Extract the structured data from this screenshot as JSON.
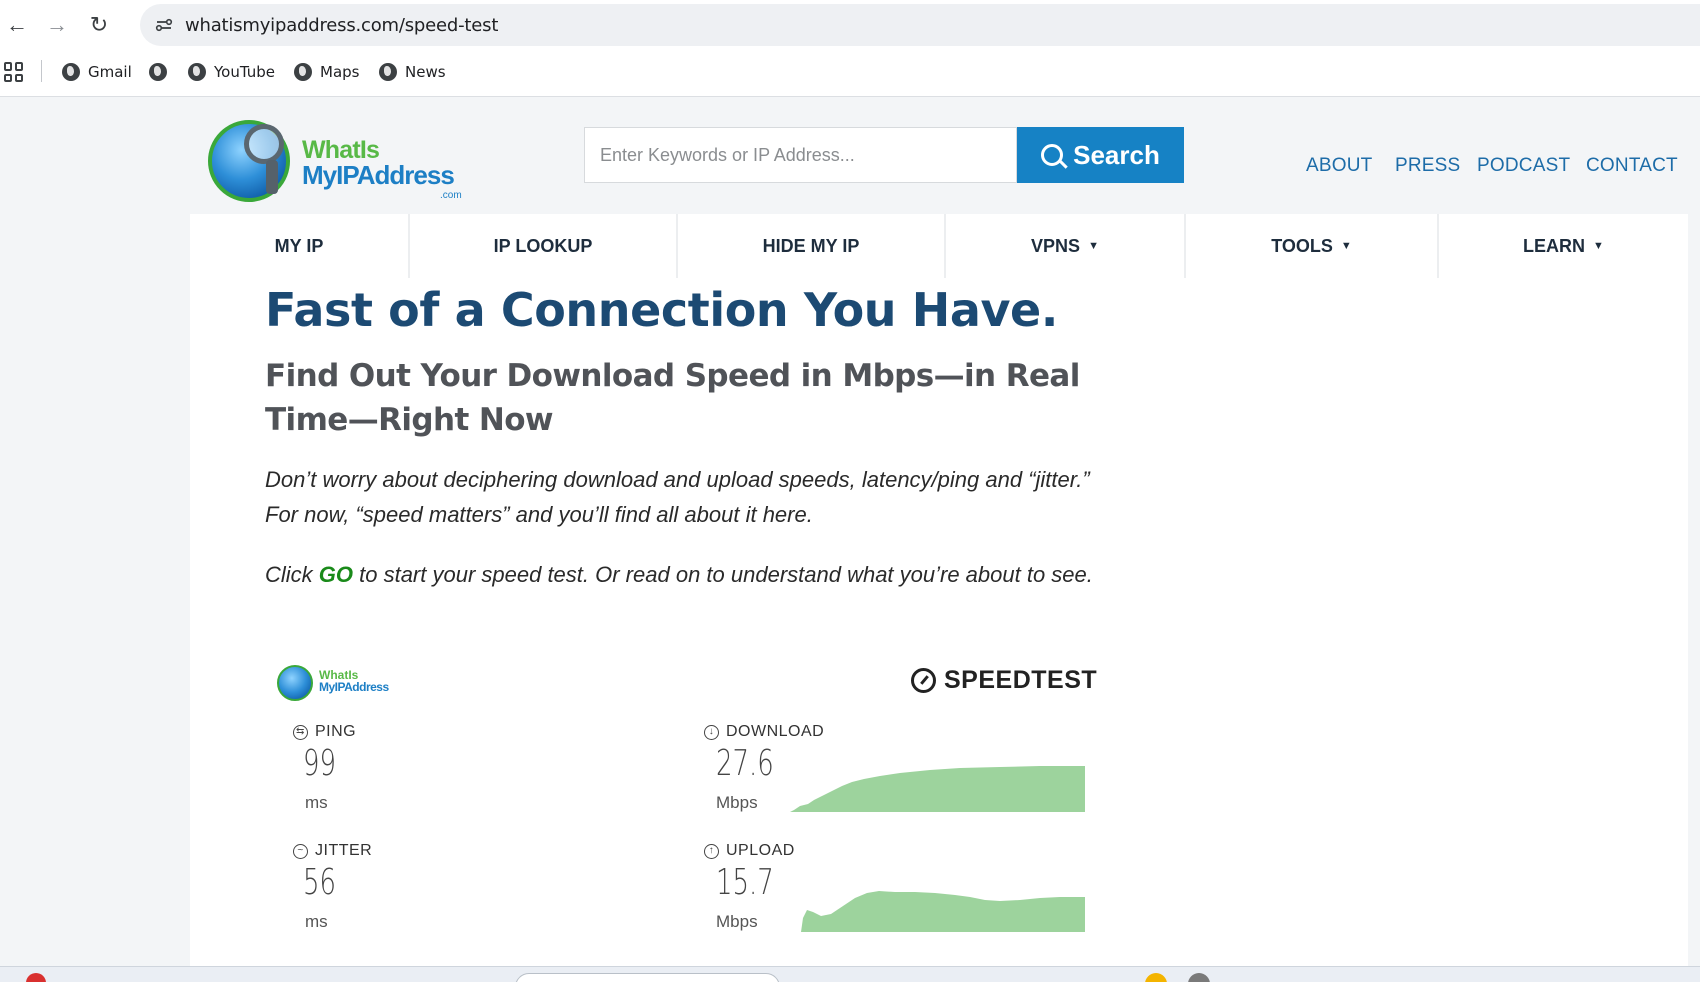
{
  "browser": {
    "url": "whatismyipaddress.com/speed-test",
    "bookmarks": [
      {
        "label": "Gmail"
      },
      {
        "label": ""
      },
      {
        "label": "YouTube"
      },
      {
        "label": "Maps"
      },
      {
        "label": "News"
      }
    ]
  },
  "site": {
    "logo": {
      "line1": "WhatIs",
      "line2": "MyIPAddress",
      "suffix": ".com"
    },
    "search": {
      "placeholder": "Enter Keywords or IP Address...",
      "button_label": "Search"
    },
    "top_links": [
      "ABOUT",
      "PRESS",
      "PODCAST",
      "CONTACT"
    ],
    "main_nav": [
      {
        "label": "MY IP",
        "dropdown": false
      },
      {
        "label": "IP LOOKUP",
        "dropdown": false
      },
      {
        "label": "HIDE MY IP",
        "dropdown": false
      },
      {
        "label": "VPNS",
        "dropdown": true
      },
      {
        "label": "TOOLS",
        "dropdown": true
      },
      {
        "label": "LEARN",
        "dropdown": true
      }
    ],
    "caret": "▼"
  },
  "content": {
    "headline": "Fast of a Connection You Have.",
    "subheadline": "Find Out Your Download Speed in Mbps—in Real Time—Right Now",
    "intro": "Don’t worry about deciphering download and upload speeds, latency/ping and “jitter.” For now, “speed matters” and you’ll find all about it here.",
    "cta_before": "Click ",
    "cta_go": "GO",
    "cta_after": " to start your speed test. Or read on to understand what you’re about to see."
  },
  "speedtest": {
    "brand": "SPEEDTEST",
    "widget_logo": {
      "line1": "WhatIs",
      "line2": "MyIPAddress"
    },
    "ping": {
      "label": "PING",
      "value": "99",
      "unit": "ms"
    },
    "jitter": {
      "label": "JITTER",
      "value": "56",
      "unit": "ms"
    },
    "download": {
      "label": "DOWNLOAD",
      "value": "27.6",
      "unit": "Mbps"
    },
    "upload": {
      "label": "UPLOAD",
      "value": "15.7",
      "unit": "Mbps"
    },
    "chart_color": "#9dd39d"
  },
  "colors": {
    "accent": "#1682c5",
    "heading": "#1c4a73",
    "nav_link": "#1d6ca8",
    "go": "#1a8a1a"
  }
}
